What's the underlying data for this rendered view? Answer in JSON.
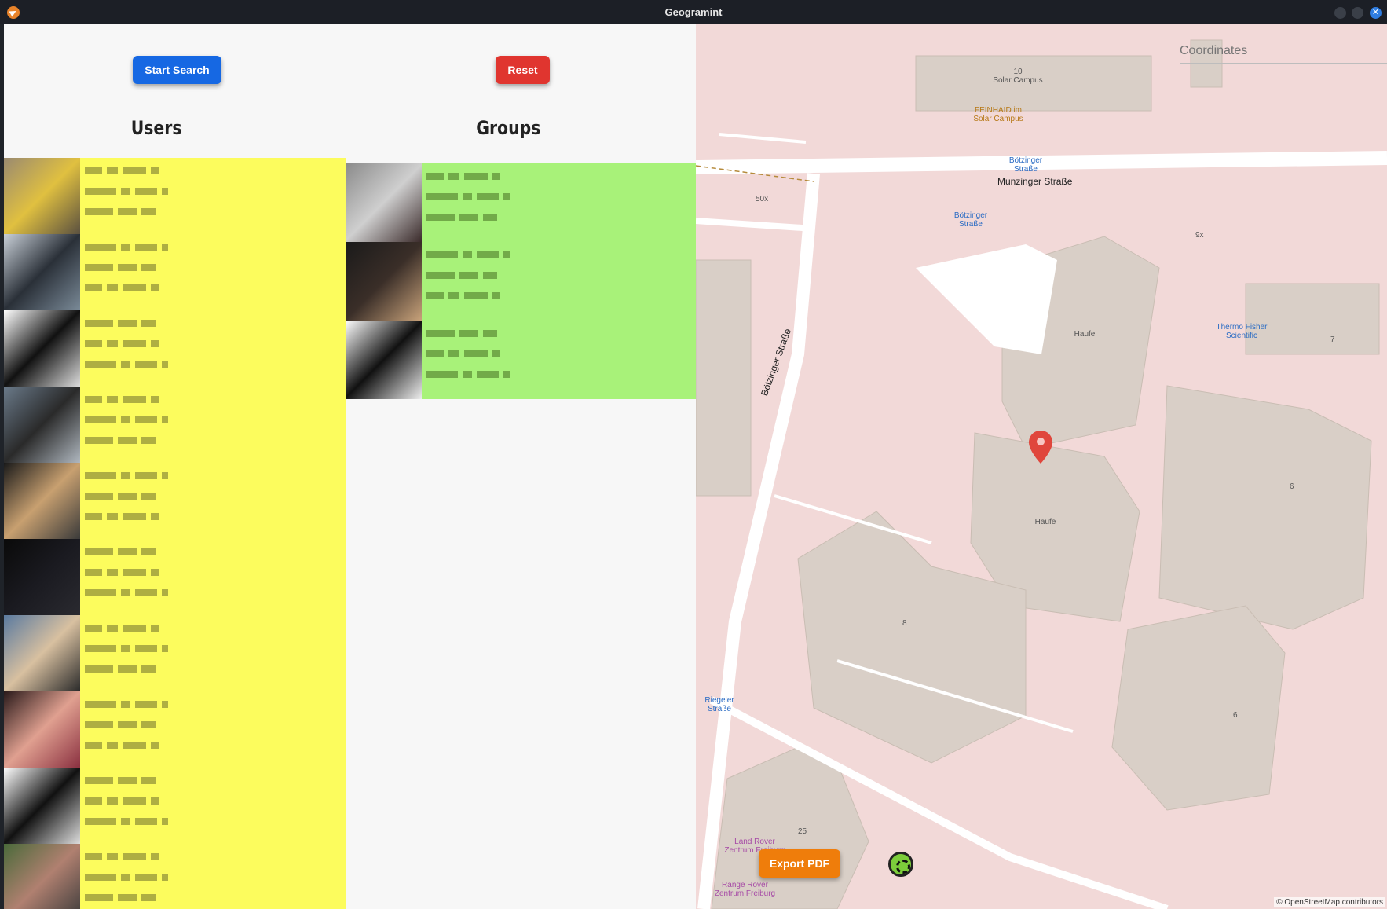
{
  "window": {
    "title": "Geogramint",
    "close_symbol": "✕"
  },
  "toolbar": {
    "start_label": "Start Search",
    "reset_label": "Reset"
  },
  "users": {
    "heading": "Users",
    "rows": 10
  },
  "groups": {
    "heading": "Groups",
    "rows": 3
  },
  "map": {
    "coords_placeholder": "Coordinates",
    "export_label": "Export PDF",
    "attribution": "© OpenStreetMap contributors",
    "streets": [
      "Munzinger Straße",
      "Bötzinger Straße"
    ],
    "labels": {
      "solar_campus": "10\nSolar Campus",
      "feinhaid": "FEINHAID im Solar Campus",
      "bus1": "Bötzinger Straße",
      "bus2": "Bötzinger Straße",
      "haufe1": "Haufe",
      "haufe2": "Haufe",
      "thermo": "Thermo Fisher Scientific",
      "riegeler": "Riegeler Straße",
      "land_rover": "Land Rover Zentrum Freiburg",
      "range_rover": "Range Rover Zentrum Freiburg",
      "n8": "8",
      "n6a": "6",
      "n6b": "6",
      "n25": "25",
      "n9x": "9x",
      "n50x": "50x",
      "n7": "7"
    }
  },
  "colors": {
    "users_bg": "#fcfc5d",
    "groups_bg": "#a8f279",
    "start": "#1668e3",
    "reset": "#e0352f",
    "export": "#ef7d0b",
    "map_bg": "#f2d9d8",
    "marker": "#e0463c"
  }
}
